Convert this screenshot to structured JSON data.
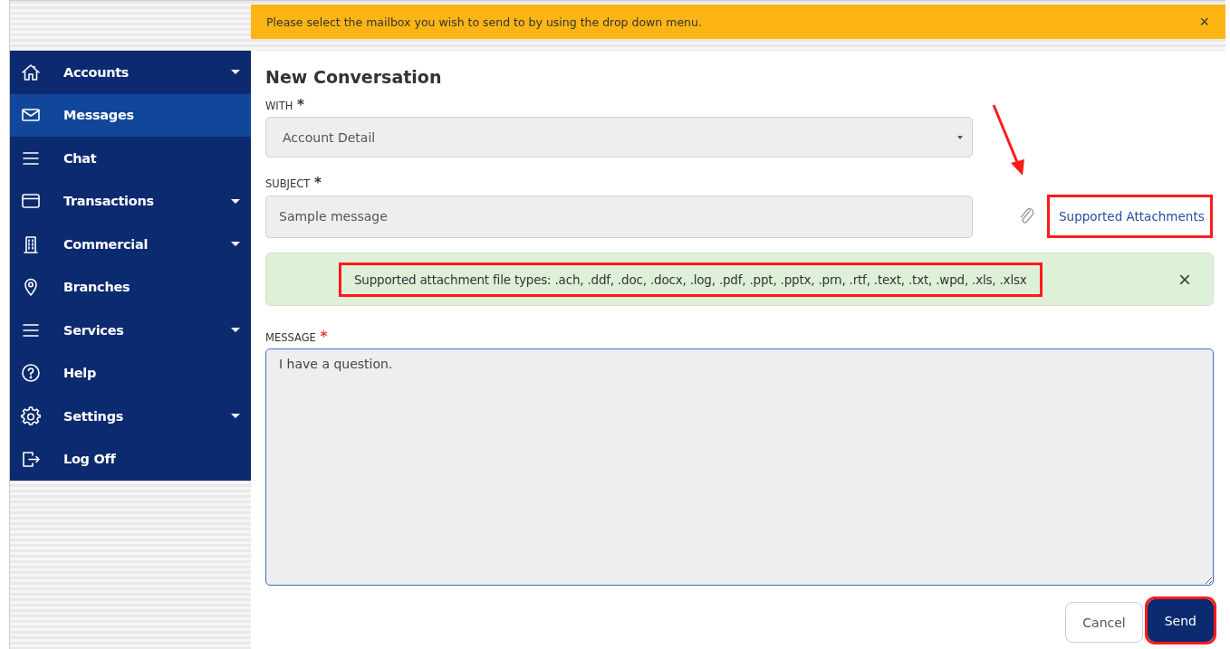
{
  "banner": {
    "text": "Please select the mailbox you wish to send to by using the drop down menu.",
    "close": "×"
  },
  "sidebar": {
    "items": [
      {
        "label": "Accounts",
        "has_caret": true,
        "selected": false
      },
      {
        "label": "Messages",
        "has_caret": false,
        "selected": true
      },
      {
        "label": "Chat",
        "has_caret": false,
        "selected": false
      },
      {
        "label": "Transactions",
        "has_caret": true,
        "selected": false
      },
      {
        "label": "Commercial",
        "has_caret": true,
        "selected": false
      },
      {
        "label": "Branches",
        "has_caret": false,
        "selected": false
      },
      {
        "label": "Services",
        "has_caret": true,
        "selected": false
      },
      {
        "label": "Help",
        "has_caret": false,
        "selected": false
      },
      {
        "label": "Settings",
        "has_caret": true,
        "selected": false
      },
      {
        "label": "Log Off",
        "has_caret": false,
        "selected": false
      }
    ]
  },
  "form": {
    "title": "New Conversation",
    "with": {
      "label": "WITH",
      "asterisk": {
        "text": "*",
        "color": "#333333"
      },
      "value": "Account Detail"
    },
    "subject": {
      "label": "SUBJECT",
      "asterisk": {
        "text": "*",
        "color": "#333333"
      },
      "value": "Sample message"
    },
    "attachments_link": {
      "text": "Supported Attachments",
      "highlighted": true,
      "arrow": true
    },
    "alert": {
      "text": "Supported attachment file types: .ach, .ddf, .doc, .docx, .log, .pdf, .ppt, .pptx, .prn, .rtf, .text, .txt, .wpd, .xls, .xlsx",
      "highlighted": true,
      "close": "×"
    },
    "message": {
      "label": "MESSAGE",
      "asterisk": {
        "text": "*",
        "color": "#e53935"
      },
      "value": "I have a question."
    },
    "buttons": [
      {
        "label": "Cancel",
        "kind": "secondary",
        "highlighted": false
      },
      {
        "label": "Send",
        "kind": "primary",
        "highlighted": true
      }
    ]
  }
}
